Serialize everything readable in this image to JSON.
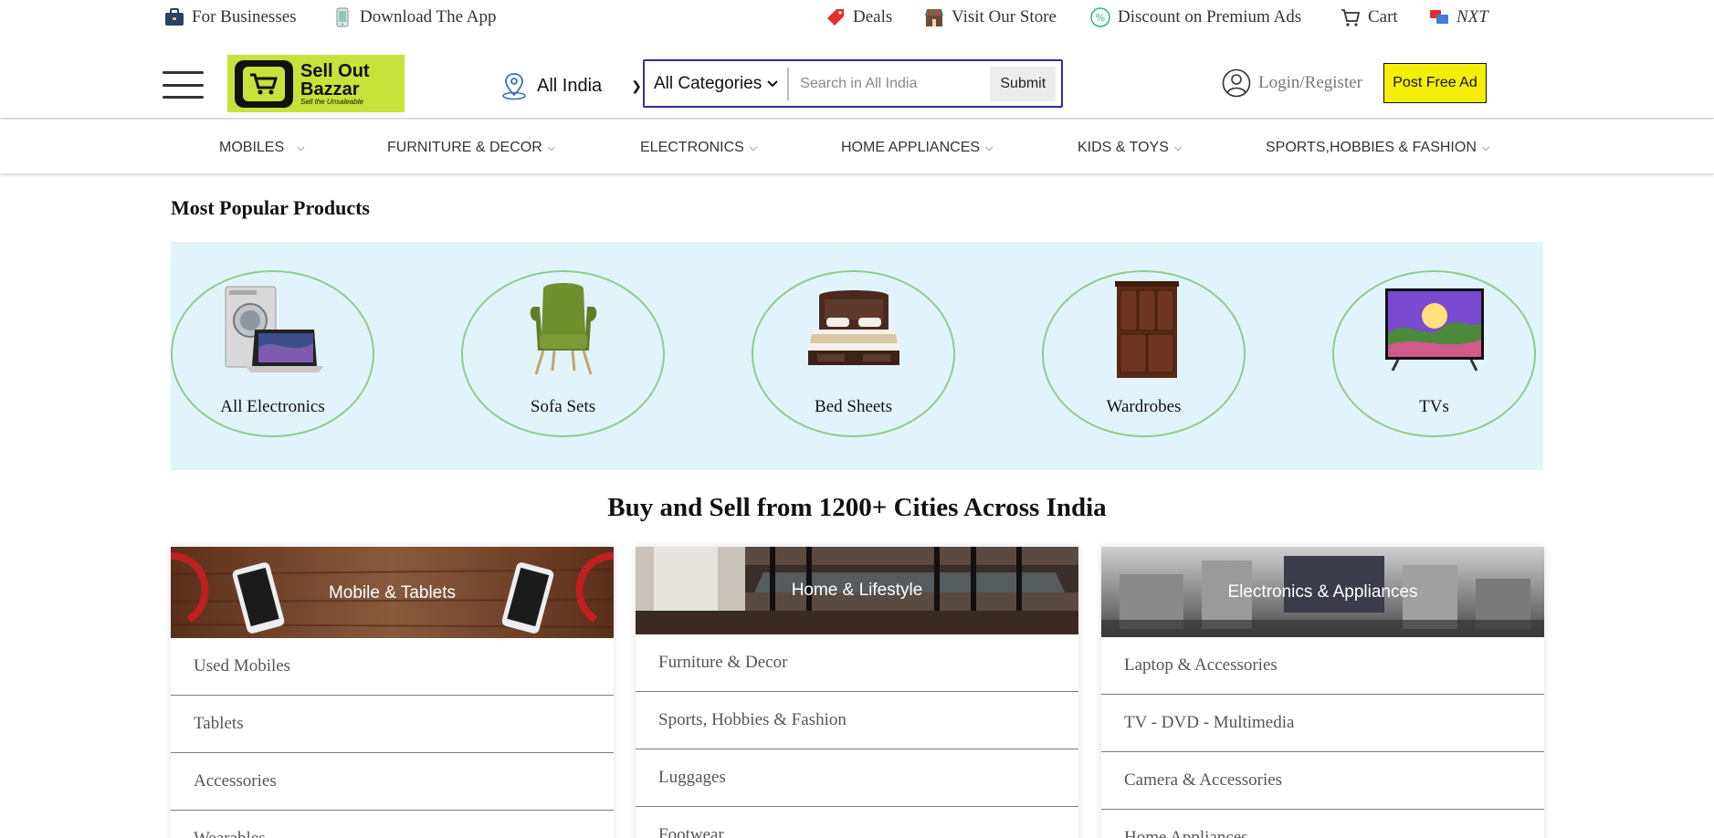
{
  "topbar": {
    "for_businesses": "For Businesses",
    "download_app": "Download The App",
    "deals": "Deals",
    "visit_store": "Visit Our Store",
    "discount": "Discount on Premium Ads",
    "cart": "Cart",
    "nxt": "NXT"
  },
  "header": {
    "logo_line1": "Sell Out",
    "logo_line2": "Bazzar",
    "logo_tagline": "Sell the Unsaleable",
    "location": "All India",
    "category_select": "All Categories",
    "search_placeholder": "Search in All India",
    "submit_label": "Submit",
    "login_label": "Login/Register",
    "post_ad_label": "Post Free Ad"
  },
  "nav": {
    "items": [
      {
        "label": "MOBILES"
      },
      {
        "label": "FURNITURE & DECOR"
      },
      {
        "label": "ELECTRONICS"
      },
      {
        "label": "HOME APPLIANCES"
      },
      {
        "label": "KIDS & TOYS"
      },
      {
        "label": "SPORTS,HOBBIES & FASHION"
      }
    ]
  },
  "popular": {
    "title": "Most Popular Products",
    "items": [
      {
        "label": "All Electronics"
      },
      {
        "label": "Sofa Sets"
      },
      {
        "label": "Bed Sheets"
      },
      {
        "label": "Wardrobes"
      },
      {
        "label": "TVs"
      }
    ]
  },
  "cities_title": "Buy and Sell from 1200+ Cities Across India",
  "cards": [
    {
      "title": "Mobile & Tablets",
      "links": [
        "Used Mobiles",
        "Tablets",
        "Accessories",
        "Wearables"
      ]
    },
    {
      "title": "Home & Lifestyle",
      "links": [
        "Furniture & Decor",
        "Sports, Hobbies & Fashion",
        "Luggages",
        "Footwear"
      ]
    },
    {
      "title": "Electronics & Appliances",
      "links": [
        "Laptop & Accessories",
        "TV - DVD - Multimedia",
        "Camera & Accessories",
        "Home Appliances"
      ]
    }
  ],
  "colors": {
    "accent_logo": "#c7e23a",
    "post_ad_bg": "#f5ee0b",
    "search_border": "#2e2e9e",
    "popular_bg": "#e2f4fb",
    "circle_border": "#8dcc8d"
  }
}
